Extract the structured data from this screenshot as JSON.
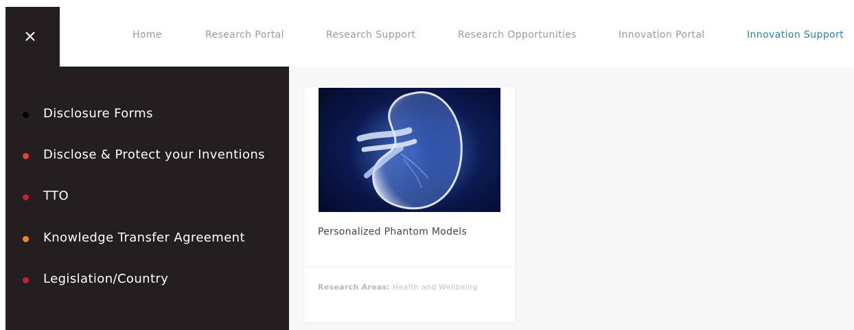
{
  "close_button": {
    "icon": "close-icon"
  },
  "nav": {
    "items": [
      {
        "label": "Home",
        "active": false
      },
      {
        "label": "Research Portal",
        "active": false
      },
      {
        "label": "Research Support",
        "active": false
      },
      {
        "label": "Research Opportunities",
        "active": false
      },
      {
        "label": "Innovation Portal",
        "active": false
      },
      {
        "label": "Innovation Support",
        "active": true
      }
    ],
    "active_color": "#2a7fbf"
  },
  "side_menu": {
    "items": [
      {
        "label": "Disclosure Forms",
        "dot_color": "#000000"
      },
      {
        "label": "Disclose & Protect your Inventions",
        "dot_color": "#e8402c"
      },
      {
        "label": "TTO",
        "dot_color": "#c8202a"
      },
      {
        "label": "Knowledge Transfer Agreement",
        "dot_color": "#f08a1c"
      },
      {
        "label": "Legislation/Country",
        "dot_color": "#c8202a"
      }
    ]
  },
  "card": {
    "image": "kidney-xray-image",
    "title": "Personalized Phantom Models",
    "meta_label": "Research Areas:",
    "meta_value": "Health and Wellbeing"
  }
}
